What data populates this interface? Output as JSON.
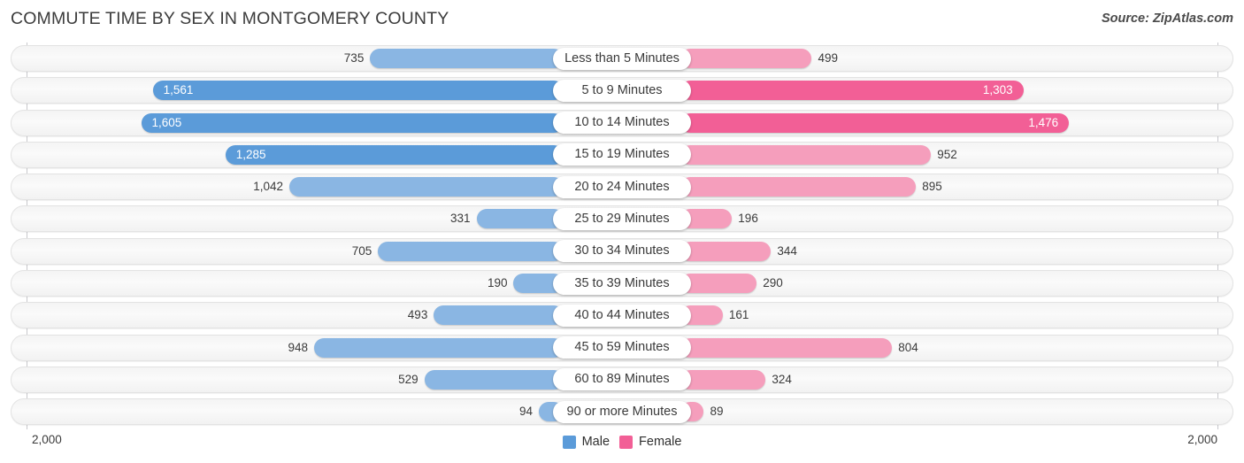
{
  "header": {
    "title": "COMMUTE TIME BY SEX IN MONTGOMERY COUNTY",
    "source": "Source: ZipAtlas.com"
  },
  "axis": {
    "left_tick": "2,000",
    "right_tick": "2,000"
  },
  "legend": [
    {
      "label": "Male",
      "color": "#5b9bd9"
    },
    {
      "label": "Female",
      "color": "#f25f96"
    }
  ],
  "colors": {
    "male_dark": "#5b9bd9",
    "male_light": "#8ab6e3",
    "female_dark": "#f25f96",
    "female_light": "#f59ebc",
    "track": "#f5f5f5",
    "axis": "#c8c8cc"
  },
  "chart_data": {
    "type": "bar",
    "title": "COMMUTE TIME BY SEX IN MONTGOMERY COUNTY",
    "subtitle": "",
    "orientation": "horizontal-diverging",
    "xlabel": "",
    "ylabel": "",
    "xlim": [
      2000,
      2000
    ],
    "grid": false,
    "legend_position": "bottom-center",
    "categories": [
      "Less than 5 Minutes",
      "5 to 9 Minutes",
      "10 to 14 Minutes",
      "15 to 19 Minutes",
      "20 to 24 Minutes",
      "25 to 29 Minutes",
      "30 to 34 Minutes",
      "35 to 39 Minutes",
      "40 to 44 Minutes",
      "45 to 59 Minutes",
      "60 to 89 Minutes",
      "90 or more Minutes"
    ],
    "series": [
      {
        "name": "Male",
        "direction": "left",
        "color": "#5b9bd9",
        "values": [
          735,
          1561,
          1605,
          1285,
          1042,
          331,
          705,
          190,
          493,
          948,
          529,
          94
        ],
        "labels": [
          "735",
          "1,561",
          "1,605",
          "1,285",
          "1,042",
          "331",
          "705",
          "190",
          "493",
          "948",
          "529",
          "94"
        ]
      },
      {
        "name": "Female",
        "direction": "right",
        "color": "#f25f96",
        "values": [
          499,
          1303,
          1476,
          952,
          895,
          196,
          344,
          290,
          161,
          804,
          324,
          89
        ],
        "labels": [
          "499",
          "1,303",
          "1,476",
          "952",
          "895",
          "196",
          "344",
          "290",
          "161",
          "804",
          "324",
          "89"
        ]
      }
    ]
  }
}
